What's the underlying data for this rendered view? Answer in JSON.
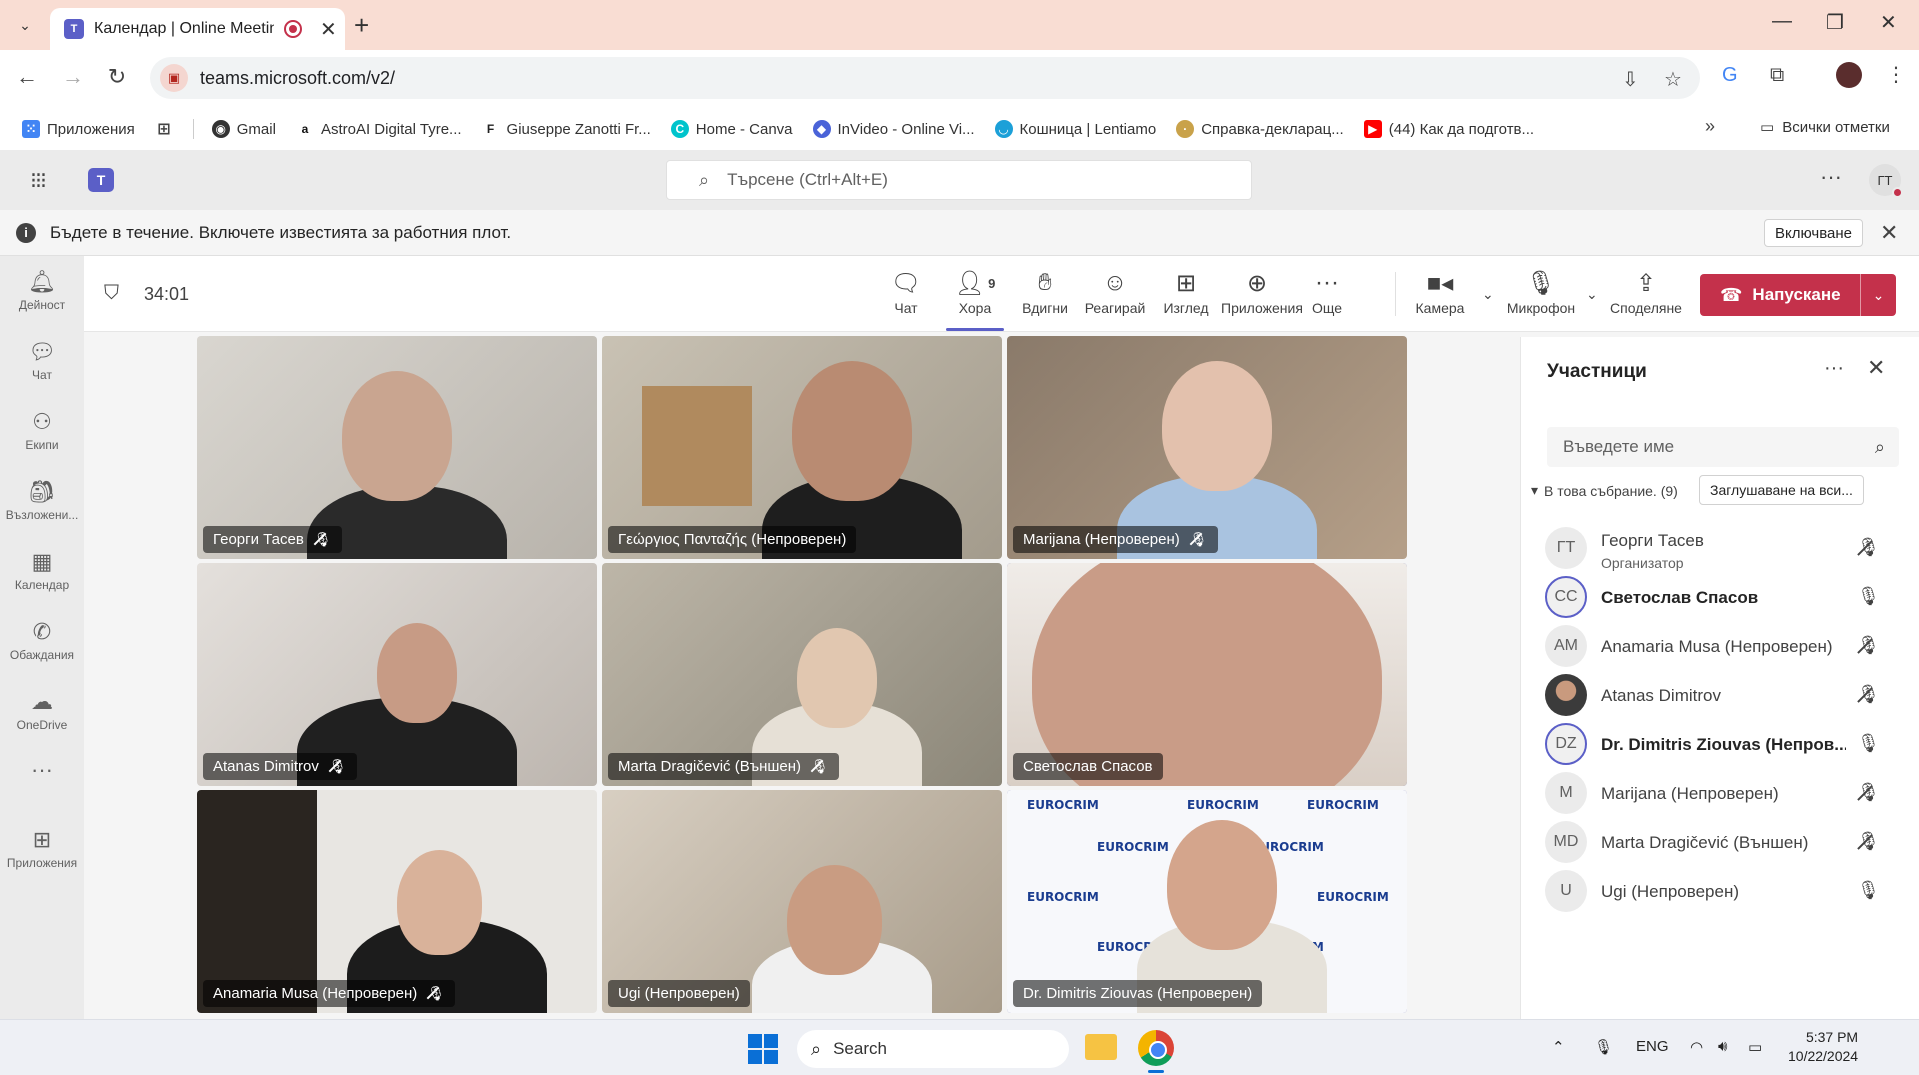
{
  "browser": {
    "tab_title": "Календар | Online Meeting",
    "url": "teams.microsoft.com/v2/",
    "bookmarks": [
      {
        "label": "Приложения",
        "color": "#4285f4"
      },
      {
        "label": "Gmail",
        "color": "#ea4335"
      },
      {
        "label": "AstroAI Digital Tyre...",
        "color": "#111111"
      },
      {
        "label": "Giuseppe Zanotti Fr...",
        "color": "#222222"
      },
      {
        "label": "Home - Canva",
        "color": "#00c4cc"
      },
      {
        "label": "InVideo - Online Vi...",
        "color": "#4a63d8"
      },
      {
        "label": "Кошница | Lentiamo",
        "color": "#1ca0d8"
      },
      {
        "label": "Справка-декларац...",
        "color": "#c9a24a"
      },
      {
        "label": "(44) Как да подготв...",
        "color": "#ff0000"
      }
    ],
    "all_bookmarks": "Всички отметки"
  },
  "teams": {
    "search_placeholder": "Търсене (Ctrl+Alt+E)",
    "user_initials": "ГТ",
    "notification_text": "Бъдете в течение. Включете известията за работния плот.",
    "notification_button": "Включване"
  },
  "rail": [
    {
      "label": "Дейност",
      "icon": "bell-icon"
    },
    {
      "label": "Чат",
      "icon": "chat-icon"
    },
    {
      "label": "Екипи",
      "icon": "teams-icon"
    },
    {
      "label": "Възложени...",
      "icon": "assignments-icon"
    },
    {
      "label": "Календар",
      "icon": "calendar-icon"
    },
    {
      "label": "Обаждания",
      "icon": "phone-icon"
    },
    {
      "label": "OneDrive",
      "icon": "cloud-icon"
    },
    {
      "label": "Приложения",
      "icon": "apps-add-icon"
    }
  ],
  "meeting": {
    "timer": "34:01",
    "toolbar": {
      "chat": "Чат",
      "people": "Хора",
      "people_count": "9",
      "raise": "Вдигни",
      "react": "Реагирай",
      "view": "Изглед",
      "apps": "Приложения",
      "more": "Още",
      "camera": "Камера",
      "mic": "Микрофон",
      "share": "Споделяне",
      "leave": "Напускане"
    },
    "tiles": [
      {
        "name": "Георги Тасев",
        "muted": true
      },
      {
        "name": "Γεώργιος Πανταζής (Непроверен)",
        "muted": false
      },
      {
        "name": "Marijana (Непроверен)",
        "muted": true
      },
      {
        "name": "Atanas Dimitrov",
        "muted": true
      },
      {
        "name": "Marta Dragičević (Външен)",
        "muted": true
      },
      {
        "name": "Светослав Спасов",
        "muted": false
      },
      {
        "name": "Anamaria Musa (Непроверен)",
        "muted": true
      },
      {
        "name": "Ugi (Непроверен)",
        "muted": false
      },
      {
        "name": "Dr. Dimitris Ziouvas (Непроверен)",
        "muted": false
      }
    ],
    "banner_word": "EUROCRIM"
  },
  "participants": {
    "title": "Участници",
    "search_placeholder": "Въведете име",
    "section": "В това събрание. (9)",
    "mute_all": "Заглушаване на вси...",
    "list": [
      {
        "initials": "ГТ",
        "name": "Георги Тасев",
        "role": "Организатор",
        "muted": true
      },
      {
        "initials": "СС",
        "name": "Светослав Спасов",
        "muted": false
      },
      {
        "initials": "AM",
        "name": "Anamaria Musa (Непроверен)",
        "muted": true
      },
      {
        "initials": "",
        "name": "Atanas Dimitrov",
        "muted": true
      },
      {
        "initials": "DZ",
        "name": "Dr. Dimitris Ziouvas (Непров...",
        "muted": false
      },
      {
        "initials": "M",
        "name": "Marijana (Непроверен)",
        "muted": true
      },
      {
        "initials": "MD",
        "name": "Marta Dragičević (Външен)",
        "muted": true
      },
      {
        "initials": "U",
        "name": "Ugi (Непроверен)",
        "muted": false
      }
    ]
  },
  "taskbar": {
    "search": "Search",
    "lang": "ENG",
    "time": "5:37 PM",
    "date": "10/22/2024"
  }
}
